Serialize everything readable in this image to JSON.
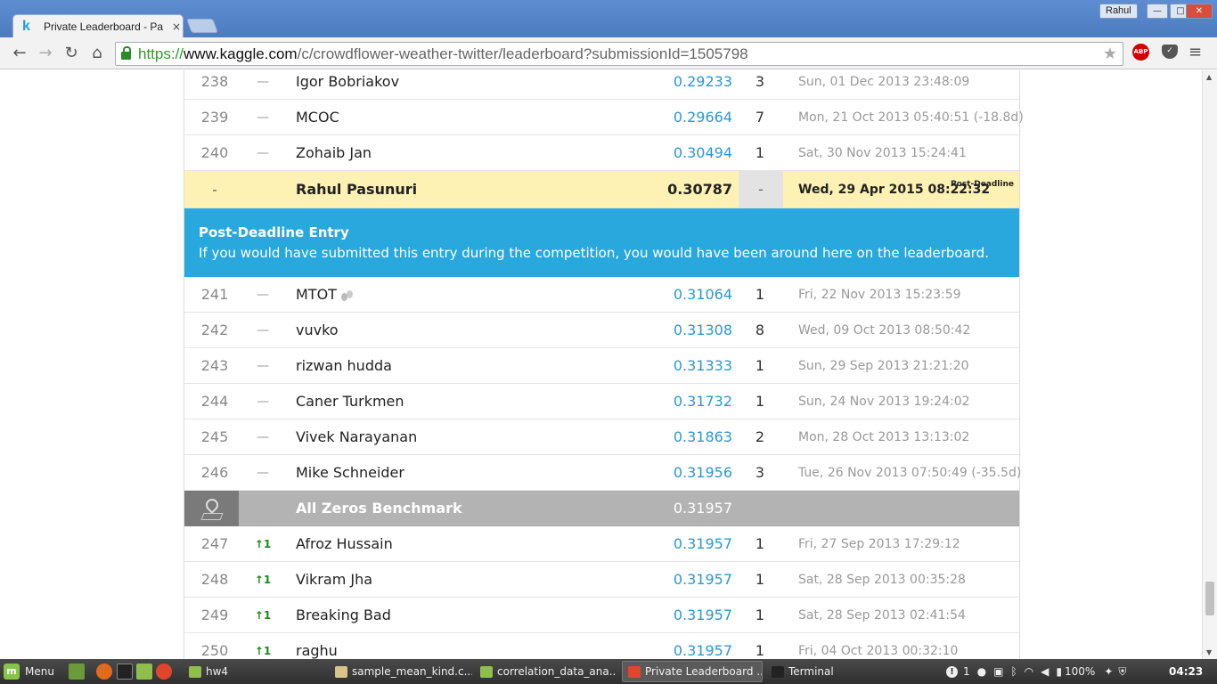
{
  "browser": {
    "tab_title": "Private Leaderboard - Pa",
    "tab_close": "×",
    "profile_name": "Rahul",
    "url_scheme": "https://",
    "url_host": "www.kaggle.com",
    "url_path": "/c/crowdflower-weather-twitter/leaderboard?submissionId=1505798",
    "abp_label": "ABP"
  },
  "leaderboard": {
    "rows_before": [
      {
        "rank": "238",
        "delta": "—",
        "name": "Igor Bobriakov",
        "score": "0.29233",
        "entries": "3",
        "last": "Sun, 01 Dec 2013 23:48:09"
      },
      {
        "rank": "239",
        "delta": "—",
        "name": "MCOC",
        "score": "0.29664",
        "entries": "7",
        "last": "Mon, 21 Oct 2013 05:40:51 (-18.8d)"
      },
      {
        "rank": "240",
        "delta": "—",
        "name": "Zohaib Jan",
        "score": "0.30494",
        "entries": "1",
        "last": "Sat, 30 Nov 2013 15:24:41"
      }
    ],
    "my_entry": {
      "rank": "-",
      "name": "Rahul Pasunuri",
      "score": "0.30787",
      "entries": "-",
      "last": "Wed, 29 Apr 2015 08:22:32",
      "tag": "Post-Deadline"
    },
    "banner": {
      "title": "Post-Deadline Entry",
      "text": "If you would have submitted this entry during the competition, you would have been around here on the leaderboard."
    },
    "rows_middle": [
      {
        "rank": "241",
        "delta": "—",
        "name": "MTOT",
        "score": "0.31064",
        "entries": "1",
        "last": "Fri, 22 Nov 2013 15:23:59",
        "team": true
      },
      {
        "rank": "242",
        "delta": "—",
        "name": "vuvko",
        "score": "0.31308",
        "entries": "8",
        "last": "Wed, 09 Oct 2013 08:50:42"
      },
      {
        "rank": "243",
        "delta": "—",
        "name": "rizwan hudda",
        "score": "0.31333",
        "entries": "1",
        "last": "Sun, 29 Sep 2013 21:21:20"
      },
      {
        "rank": "244",
        "delta": "—",
        "name": "Caner Turkmen",
        "score": "0.31732",
        "entries": "1",
        "last": "Sun, 24 Nov 2013 19:24:02"
      },
      {
        "rank": "245",
        "delta": "—",
        "name": "Vivek Narayanan",
        "score": "0.31863",
        "entries": "2",
        "last": "Mon, 28 Oct 2013 13:13:02"
      },
      {
        "rank": "246",
        "delta": "—",
        "name": "Mike Schneider",
        "score": "0.31956",
        "entries": "3",
        "last": "Tue, 26 Nov 2013 07:50:49 (-35.5d)"
      }
    ],
    "benchmark": {
      "name": "All Zeros Benchmark",
      "score": "0.31957"
    },
    "rows_after": [
      {
        "rank": "247",
        "delta": "↑1",
        "name": "Afroz Hussain",
        "score": "0.31957",
        "entries": "1",
        "last": "Fri, 27 Sep 2013 17:29:12"
      },
      {
        "rank": "248",
        "delta": "↑1",
        "name": "Vikram Jha",
        "score": "0.31957",
        "entries": "1",
        "last": "Sat, 28 Sep 2013 00:35:28"
      },
      {
        "rank": "249",
        "delta": "↑1",
        "name": "Breaking Bad",
        "score": "0.31957",
        "entries": "1",
        "last": "Sat, 28 Sep 2013 02:41:54"
      },
      {
        "rank": "250",
        "delta": "↑1",
        "name": "raghu",
        "score": "0.31957",
        "entries": "1",
        "last": "Fri, 04 Oct 2013 00:32:10"
      }
    ]
  },
  "taskbar": {
    "menu_label": "Menu",
    "windows": [
      {
        "label": "hw4",
        "icon_color": "#8fbf4a"
      },
      {
        "label": "sample_mean_kind.c...",
        "icon_color": "#d9c38a"
      },
      {
        "label": "correlation_data_ana...",
        "icon_color": "#8fbf4a"
      },
      {
        "label": "Private Leaderboard ...",
        "icon_color": "#e0452e"
      },
      {
        "label": "Terminal",
        "icon_color": "#222222"
      }
    ],
    "notif_count": "1",
    "battery": "100%",
    "clock": "04:23"
  },
  "colors": {
    "score_link": "#2a97d3",
    "highlight_row": "#fdf2b3",
    "banner": "#29a8dd",
    "benchmark_row": "#b3b3b3",
    "rank_up": "#1c8a1c"
  }
}
